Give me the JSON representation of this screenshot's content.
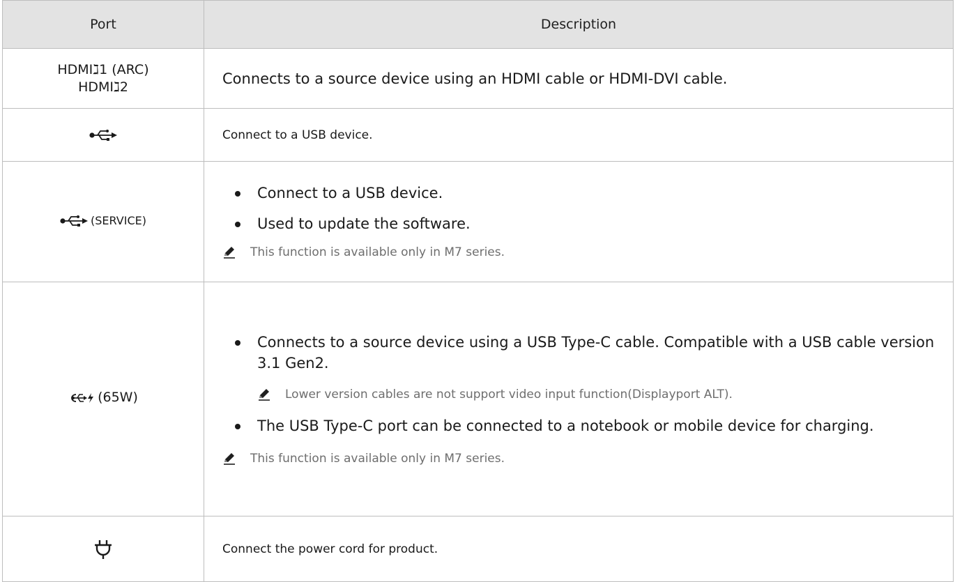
{
  "header": {
    "port": "Port",
    "description": "Description"
  },
  "rows": [
    {
      "port_line1": "HDMIℷ1 (ARC)",
      "port_line2": "HDMIℷ2",
      "text": "Connects to a source device using an HDMI cable or HDMI-DVI cable."
    },
    {
      "port_icon": "usb-icon",
      "text": "Connect to a USB device."
    },
    {
      "port_icon": "usb-icon",
      "port_suffix": "(SERVICE)",
      "bullets": [
        "Connect to a USB device.",
        "Used to update the software."
      ],
      "note_icon": "pencil-note-icon",
      "note": "This function is available only in M7 series."
    },
    {
      "port_icon": "usb-c-charge-icon",
      "port_suffix": "(65W)",
      "bullet1": "Connects to a source device using a USB Type-C cable. Compatible with a USB cable version 3.1 Gen2.",
      "sub_note": "Lower version cables are not support video input function(Displayport ALT).",
      "bullet2": "The USB Type-C port can be connected to a notebook or mobile device for charging.",
      "note": "This function is available only in M7 series."
    },
    {
      "port_icon": "power-plug-icon",
      "text": "Connect the power cord for product."
    }
  ]
}
